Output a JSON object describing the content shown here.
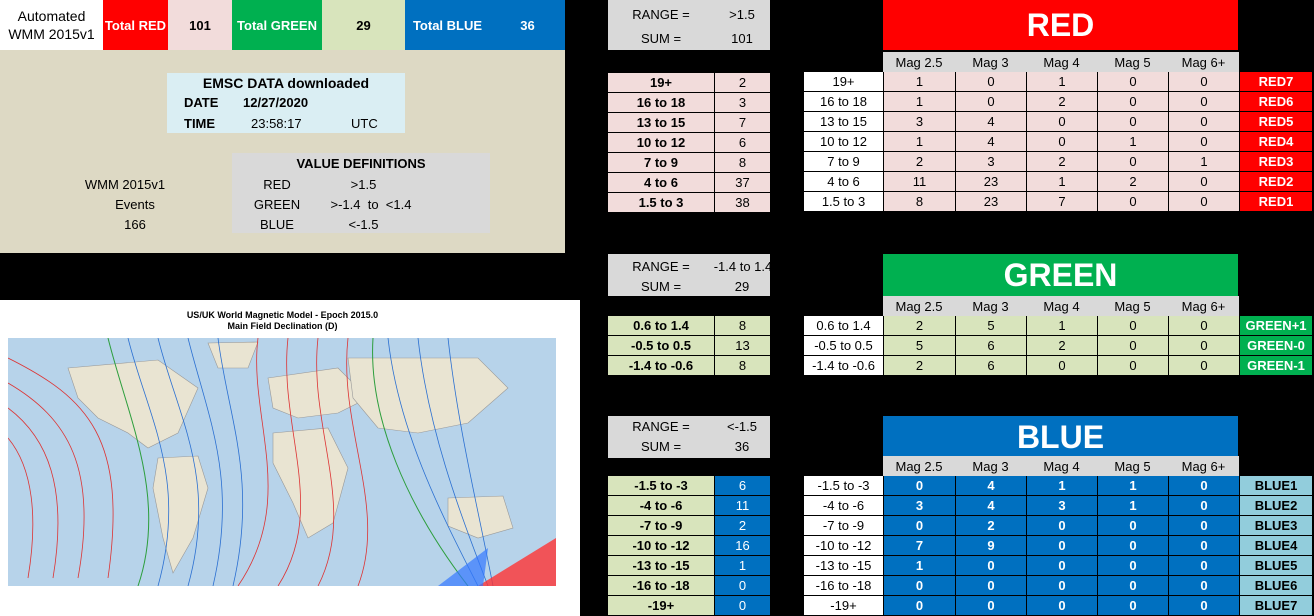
{
  "header": {
    "title_line1": "Automated",
    "title_line2": "WMM 2015v1",
    "total_red_label": "Total RED",
    "total_red_value": "101",
    "total_green_label": "Total GREEN",
    "total_green_value": "29",
    "total_blue_label": "Total BLUE",
    "total_blue_value": "36"
  },
  "emsc": {
    "title": "EMSC DATA downloaded",
    "date_label": "DATE",
    "date_value": "12/27/2020",
    "time_label": "TIME",
    "time_value": "23:58:17",
    "tz": "UTC"
  },
  "info": {
    "line1": "WMM 2015v1",
    "line2": "Events",
    "line3": "166"
  },
  "defs": {
    "title": "VALUE DEFINITIONS",
    "rows": [
      {
        "name": "RED",
        "value": ">1.5"
      },
      {
        "name": "GREEN",
        "value": ">-1.4  to  <1.4"
      },
      {
        "name": "BLUE",
        "value": "<-1.5"
      }
    ]
  },
  "map": {
    "title1": "US/UK World Magnetic Model - Epoch 2015.0",
    "title2": "Main Field Declination (D)"
  },
  "mag_headers": [
    "Mag 2.5",
    "Mag 3",
    "Mag 4",
    "Mag 5",
    "Mag 6+"
  ],
  "red": {
    "range_label": "RANGE =",
    "range_value": ">1.5",
    "sum_label": "SUM =",
    "sum_value": "101",
    "heading": "RED",
    "rows": [
      {
        "range": "19+",
        "count": "2",
        "mags": [
          "1",
          "0",
          "1",
          "0",
          "0"
        ],
        "tag": "RED7"
      },
      {
        "range": "16 to 18",
        "count": "3",
        "mags": [
          "1",
          "0",
          "2",
          "0",
          "0"
        ],
        "tag": "RED6"
      },
      {
        "range": "13 to 15",
        "count": "7",
        "mags": [
          "3",
          "4",
          "0",
          "0",
          "0"
        ],
        "tag": "RED5"
      },
      {
        "range": "10 to 12",
        "count": "6",
        "mags": [
          "1",
          "4",
          "0",
          "1",
          "0"
        ],
        "tag": "RED4"
      },
      {
        "range": "7 to 9",
        "count": "8",
        "mags": [
          "2",
          "3",
          "2",
          "0",
          "1"
        ],
        "tag": "RED3"
      },
      {
        "range": "4 to 6",
        "count": "37",
        "mags": [
          "11",
          "23",
          "1",
          "2",
          "0"
        ],
        "tag": "RED2"
      },
      {
        "range": "1.5 to 3",
        "count": "38",
        "mags": [
          "8",
          "23",
          "7",
          "0",
          "0"
        ],
        "tag": "RED1"
      }
    ]
  },
  "green": {
    "range_label": "RANGE =",
    "range_value": "-1.4 to 1.4",
    "sum_label": "SUM =",
    "sum_value": "29",
    "heading": "GREEN",
    "rows": [
      {
        "range": "0.6 to 1.4",
        "count": "8",
        "mags": [
          "2",
          "5",
          "1",
          "0",
          "0"
        ],
        "tag": "GREEN+1"
      },
      {
        "range": "-0.5 to 0.5",
        "count": "13",
        "mags": [
          "5",
          "6",
          "2",
          "0",
          "0"
        ],
        "tag": "GREEN-0"
      },
      {
        "range": "-1.4 to -0.6",
        "count": "8",
        "mags": [
          "2",
          "6",
          "0",
          "0",
          "0"
        ],
        "tag": "GREEN-1"
      }
    ]
  },
  "blue": {
    "range_label": "RANGE =",
    "range_value": "<-1.5",
    "sum_label": "SUM =",
    "sum_value": "36",
    "heading": "BLUE",
    "rows": [
      {
        "range": "-1.5 to -3",
        "count": "6",
        "mags": [
          "0",
          "4",
          "1",
          "1",
          "0"
        ],
        "tag": "BLUE1"
      },
      {
        "range": "-4 to -6",
        "count": "11",
        "mags": [
          "3",
          "4",
          "3",
          "1",
          "0"
        ],
        "tag": "BLUE2"
      },
      {
        "range": "-7 to -9",
        "count": "2",
        "mags": [
          "0",
          "2",
          "0",
          "0",
          "0"
        ],
        "tag": "BLUE3"
      },
      {
        "range": "-10 to -12",
        "count": "16",
        "mags": [
          "7",
          "9",
          "0",
          "0",
          "0"
        ],
        "tag": "BLUE4"
      },
      {
        "range": "-13 to -15",
        "count": "1",
        "mags": [
          "1",
          "0",
          "0",
          "0",
          "0"
        ],
        "tag": "BLUE5"
      },
      {
        "range": "-16 to -18",
        "count": "0",
        "mags": [
          "0",
          "0",
          "0",
          "0",
          "0"
        ],
        "tag": "BLUE6"
      },
      {
        "range": "-19+",
        "count": "0",
        "mags": [
          "0",
          "0",
          "0",
          "0",
          "0"
        ],
        "tag": "BLUE7"
      }
    ]
  }
}
